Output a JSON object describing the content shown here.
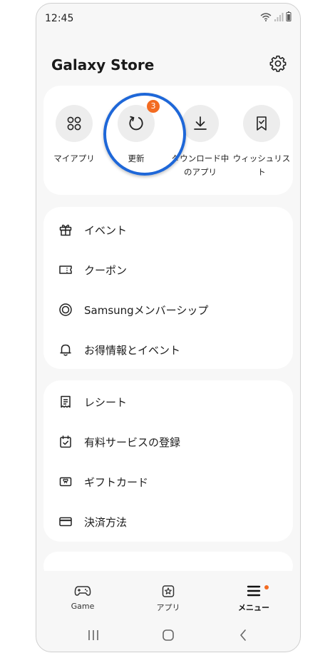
{
  "status_bar": {
    "time": "12:45"
  },
  "header": {
    "title": "Galaxy Store"
  },
  "quick_actions": [
    {
      "label": "マイアプリ",
      "icon": "apps-grid-icon"
    },
    {
      "label": "更新",
      "icon": "refresh-icon",
      "badge": "3"
    },
    {
      "label": "ダウンロード中のアプリ",
      "icon": "download-icon"
    },
    {
      "label": "ウィッシュリスト",
      "icon": "bookmark-heart-icon"
    }
  ],
  "menu_group_1": [
    {
      "label": "イベント",
      "icon": "gift-icon"
    },
    {
      "label": "クーポン",
      "icon": "coupon-icon"
    },
    {
      "label": "Samsungメンバーシップ",
      "icon": "membership-icon"
    },
    {
      "label": "お得情報とイベント",
      "icon": "bell-icon"
    }
  ],
  "menu_group_2": [
    {
      "label": "レシート",
      "icon": "receipt-icon"
    },
    {
      "label": "有料サービスの登録",
      "icon": "subscription-calendar-icon"
    },
    {
      "label": "ギフトカード",
      "icon": "gift-card-icon"
    },
    {
      "label": "決済方法",
      "icon": "credit-card-icon"
    }
  ],
  "bottom_nav": [
    {
      "label": "Game",
      "icon": "gamepad-icon"
    },
    {
      "label": "アプリ",
      "icon": "star-square-icon"
    },
    {
      "label": "メニュー",
      "icon": "menu-icon",
      "notification": true
    }
  ],
  "colors": {
    "accent": "#f36b21",
    "highlight_ring": "#1e67d8",
    "background": "#f7f7f7",
    "card": "#ffffff"
  }
}
